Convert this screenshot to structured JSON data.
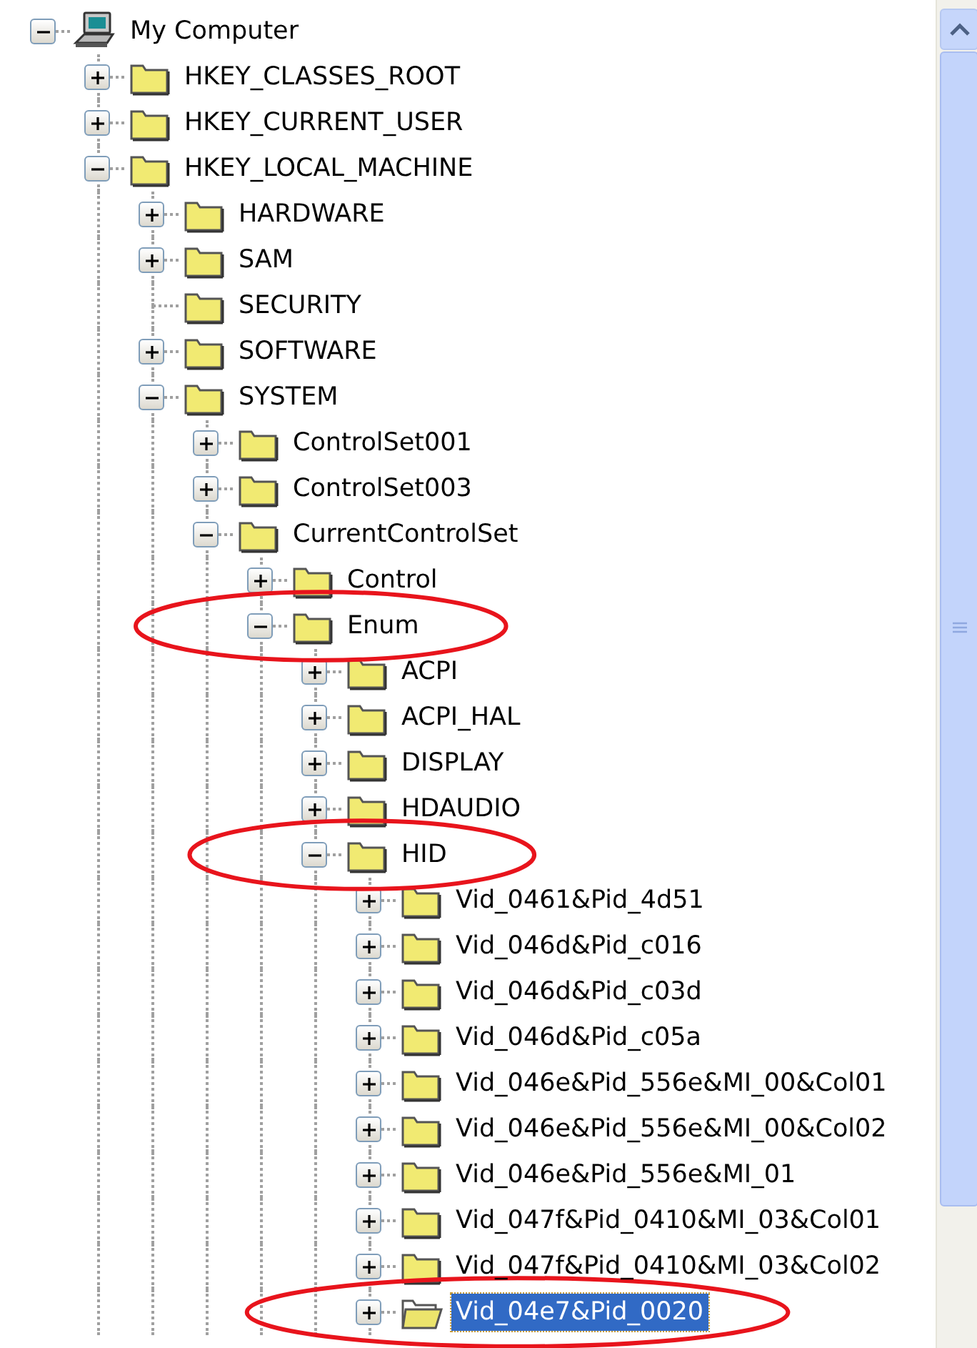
{
  "tree": [
    {
      "label": "My Computer",
      "kind": "computer",
      "has_children": true,
      "expanded": true,
      "selected": false,
      "circled": false,
      "children": [
        {
          "label": "HKEY_CLASSES_ROOT",
          "kind": "folder",
          "has_children": true,
          "expanded": false,
          "selected": false,
          "circled": false
        },
        {
          "label": "HKEY_CURRENT_USER",
          "kind": "folder",
          "has_children": true,
          "expanded": false,
          "selected": false,
          "circled": false
        },
        {
          "label": "HKEY_LOCAL_MACHINE",
          "kind": "folder",
          "has_children": true,
          "expanded": true,
          "selected": false,
          "circled": false,
          "children": [
            {
              "label": "HARDWARE",
              "kind": "folder",
              "has_children": true,
              "expanded": false,
              "selected": false,
              "circled": false
            },
            {
              "label": "SAM",
              "kind": "folder",
              "has_children": true,
              "expanded": false,
              "selected": false,
              "circled": false
            },
            {
              "label": "SECURITY",
              "kind": "folder",
              "has_children": false,
              "selected": false,
              "circled": false
            },
            {
              "label": "SOFTWARE",
              "kind": "folder",
              "has_children": true,
              "expanded": false,
              "selected": false,
              "circled": false
            },
            {
              "label": "SYSTEM",
              "kind": "folder",
              "has_children": true,
              "expanded": true,
              "selected": false,
              "circled": false,
              "children": [
                {
                  "label": "ControlSet001",
                  "kind": "folder",
                  "has_children": true,
                  "expanded": false,
                  "selected": false,
                  "circled": false
                },
                {
                  "label": "ControlSet003",
                  "kind": "folder",
                  "has_children": true,
                  "expanded": false,
                  "selected": false,
                  "circled": false
                },
                {
                  "label": "CurrentControlSet",
                  "kind": "folder",
                  "has_children": true,
                  "expanded": true,
                  "selected": false,
                  "circled": false,
                  "children": [
                    {
                      "label": "Control",
                      "kind": "folder",
                      "has_children": true,
                      "expanded": false,
                      "selected": false,
                      "circled": false
                    },
                    {
                      "label": "Enum",
                      "kind": "folder",
                      "has_children": true,
                      "expanded": true,
                      "selected": false,
                      "circled": true,
                      "children": [
                        {
                          "label": "ACPI",
                          "kind": "folder",
                          "has_children": true,
                          "expanded": false,
                          "selected": false,
                          "circled": false
                        },
                        {
                          "label": "ACPI_HAL",
                          "kind": "folder",
                          "has_children": true,
                          "expanded": false,
                          "selected": false,
                          "circled": false
                        },
                        {
                          "label": "DISPLAY",
                          "kind": "folder",
                          "has_children": true,
                          "expanded": false,
                          "selected": false,
                          "circled": false
                        },
                        {
                          "label": "HDAUDIO",
                          "kind": "folder",
                          "has_children": true,
                          "expanded": false,
                          "selected": false,
                          "circled": false
                        },
                        {
                          "label": "HID",
                          "kind": "folder",
                          "has_children": true,
                          "expanded": true,
                          "selected": false,
                          "circled": true,
                          "children": [
                            {
                              "label": "Vid_0461&Pid_4d51",
                              "kind": "folder",
                              "has_children": true,
                              "expanded": false,
                              "selected": false,
                              "circled": false
                            },
                            {
                              "label": "Vid_046d&Pid_c016",
                              "kind": "folder",
                              "has_children": true,
                              "expanded": false,
                              "selected": false,
                              "circled": false
                            },
                            {
                              "label": "Vid_046d&Pid_c03d",
                              "kind": "folder",
                              "has_children": true,
                              "expanded": false,
                              "selected": false,
                              "circled": false
                            },
                            {
                              "label": "Vid_046d&Pid_c05a",
                              "kind": "folder",
                              "has_children": true,
                              "expanded": false,
                              "selected": false,
                              "circled": false
                            },
                            {
                              "label": "Vid_046e&Pid_556e&MI_00&Col01",
                              "kind": "folder",
                              "has_children": true,
                              "expanded": false,
                              "selected": false,
                              "circled": false
                            },
                            {
                              "label": "Vid_046e&Pid_556e&MI_00&Col02",
                              "kind": "folder",
                              "has_children": true,
                              "expanded": false,
                              "selected": false,
                              "circled": false
                            },
                            {
                              "label": "Vid_046e&Pid_556e&MI_01",
                              "kind": "folder",
                              "has_children": true,
                              "expanded": false,
                              "selected": false,
                              "circled": false
                            },
                            {
                              "label": "Vid_047f&Pid_0410&MI_03&Col01",
                              "kind": "folder",
                              "has_children": true,
                              "expanded": false,
                              "selected": false,
                              "circled": false
                            },
                            {
                              "label": "Vid_047f&Pid_0410&MI_03&Col02",
                              "kind": "folder",
                              "has_children": true,
                              "expanded": false,
                              "selected": false,
                              "circled": false
                            },
                            {
                              "label": "Vid_04e7&Pid_0020",
                              "kind": "folder",
                              "has_children": true,
                              "expanded": false,
                              "selected": true,
                              "circled": true
                            }
                          ]
                        }
                      ]
                    }
                  ]
                }
              ]
            }
          ]
        }
      ]
    }
  ]
}
